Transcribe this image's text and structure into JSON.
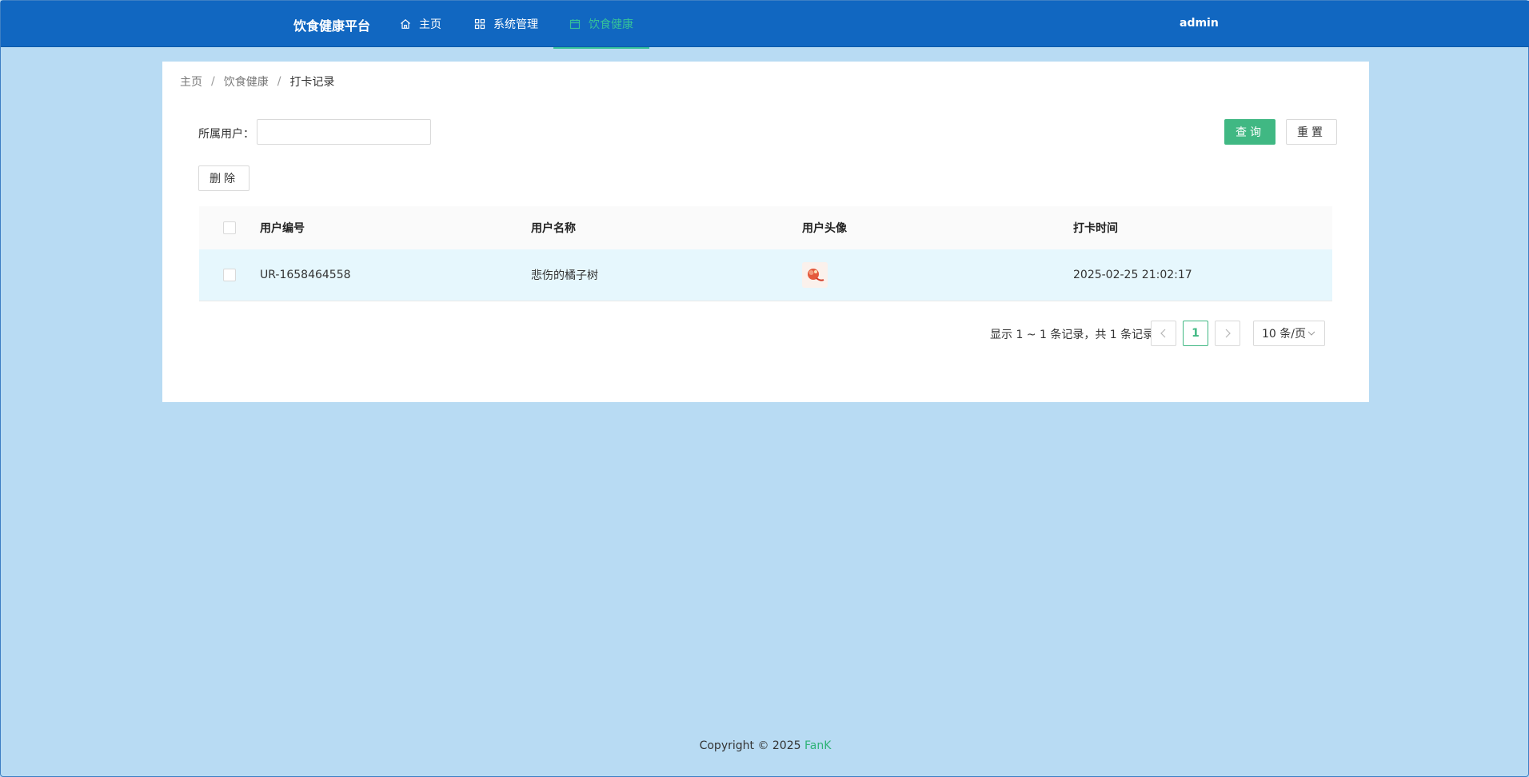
{
  "header": {
    "brand": "饮食健康平台",
    "nav": [
      {
        "label": "主页",
        "icon": "home-icon"
      },
      {
        "label": "系统管理",
        "icon": "grid-icon"
      },
      {
        "label": "饮食健康",
        "icon": "calendar-icon",
        "active": true
      }
    ],
    "user": "admin"
  },
  "breadcrumb": [
    "主页",
    "饮食健康",
    "打卡记录"
  ],
  "filter": {
    "user_label": "所属用户：",
    "user_value": "",
    "query_label": "查询",
    "reset_label": "重置"
  },
  "toolbar": {
    "delete_label": "删除"
  },
  "table": {
    "headers": [
      "用户编号",
      "用户名称",
      "用户头像",
      "打卡时间"
    ],
    "rows": [
      {
        "user_id": "UR-1658464558",
        "user_name": "悲伤的橘子树",
        "avatar": "avatar-image",
        "time": "2025-02-25 21:02:17"
      }
    ]
  },
  "pagination": {
    "info": "显示 1 ~ 1 条记录，共 1 条记录",
    "current_page": "1",
    "page_size": "10 条/页"
  },
  "footer": {
    "prefix": "Copyright © 2025 ",
    "author": "FanK"
  },
  "colors": {
    "header_bg": "#1167c1",
    "accent_green": "#40b883",
    "page_bg": "#b8dbf3",
    "row_highlight": "#e6f7fd"
  }
}
